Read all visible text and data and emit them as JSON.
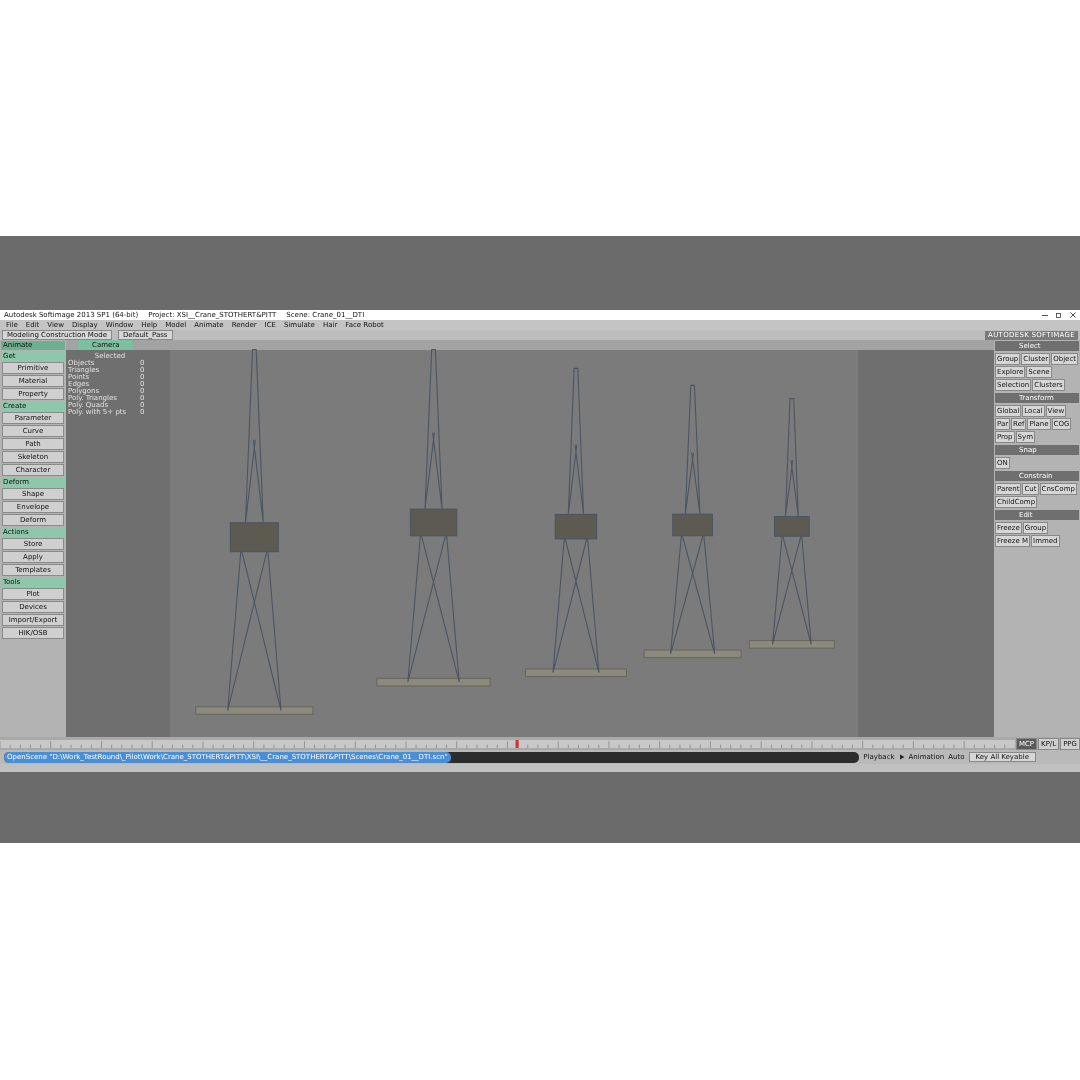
{
  "window": {
    "app": "Autodesk Softimage 2013 SP1 (64-bit)",
    "project": "Project: XSI__Crane_STOTHERT&PITT",
    "scene": "Scene: Crane_01__DTI"
  },
  "menu": [
    "File",
    "Edit",
    "View",
    "Display",
    "Window",
    "Help",
    "Model",
    "Animate",
    "Render",
    "ICE",
    "Simulate",
    "Hair",
    "Face Robot"
  ],
  "toolbar": {
    "mode": "Modeling Construction Mode",
    "pass": "Default_Pass",
    "brand": "AUTODESK SOFTIMAGE"
  },
  "left_panel": {
    "module": "Animate",
    "sections": [
      {
        "title": "Get",
        "buttons": [
          "Primitive",
          "Material",
          "Property"
        ]
      },
      {
        "title": "Create",
        "buttons": [
          "Parameter",
          "Curve",
          "Path",
          "Skeleton",
          "Character"
        ]
      },
      {
        "title": "Deform",
        "buttons": [
          "Shape",
          "Envelope",
          "Deform"
        ]
      },
      {
        "title": "Actions",
        "buttons": [
          "Store",
          "Apply",
          "Templates"
        ]
      },
      {
        "title": "Tools",
        "buttons": [
          "Plot",
          "Devices",
          "Import/Export",
          "HIK/OSB"
        ]
      }
    ]
  },
  "viewport": {
    "camera": "Camera",
    "stats_header": "Selected",
    "stats": [
      {
        "label": "Objects",
        "value": "0"
      },
      {
        "label": "Triangles",
        "value": "0"
      },
      {
        "label": "Points",
        "value": "0"
      },
      {
        "label": "Edges",
        "value": "0"
      },
      {
        "label": "Polygons",
        "value": "0"
      },
      {
        "label": "Poly. Triangles",
        "value": "0"
      },
      {
        "label": "Poly. Quads",
        "value": "0"
      },
      {
        "label": "Poly. with 5+ pts",
        "value": "0"
      }
    ]
  },
  "right_panel": {
    "sections": [
      {
        "title": "Select",
        "buttons": [
          "Group",
          "Cluster",
          "Object",
          "Explore",
          "Scene",
          "Selection",
          "Clusters"
        ]
      },
      {
        "title": "Transform",
        "buttons": [
          "Global",
          "Local",
          "View",
          "Par",
          "Ref",
          "Plane",
          "COG",
          "Prop",
          "Sym"
        ]
      },
      {
        "title": "Snap",
        "buttons": [
          "ON"
        ]
      },
      {
        "title": "Constrain",
        "buttons": [
          "Parent",
          "Cut",
          "CnsComp",
          "ChildComp"
        ]
      },
      {
        "title": "Edit",
        "buttons": [
          "Freeze",
          "Group",
          "Freeze M",
          "Immed"
        ]
      }
    ]
  },
  "timeline": {
    "tabs": [
      {
        "label": "MCP",
        "selected": true
      },
      {
        "label": "KP/L",
        "selected": false
      },
      {
        "label": "PPG",
        "selected": false
      }
    ]
  },
  "command_line": "OpenScene \"D:\\Work_TestRound\\_Pilot\\Work\\Crane_STOTHERT&PITT\\XSI\\__Crane_STOTHERT&PITT\\Scenes\\Crane_01__DTI.scn\"",
  "playback": {
    "label": "Playback",
    "animation": "Animation",
    "auto": "Auto",
    "keying": "Key All Keyable"
  }
}
